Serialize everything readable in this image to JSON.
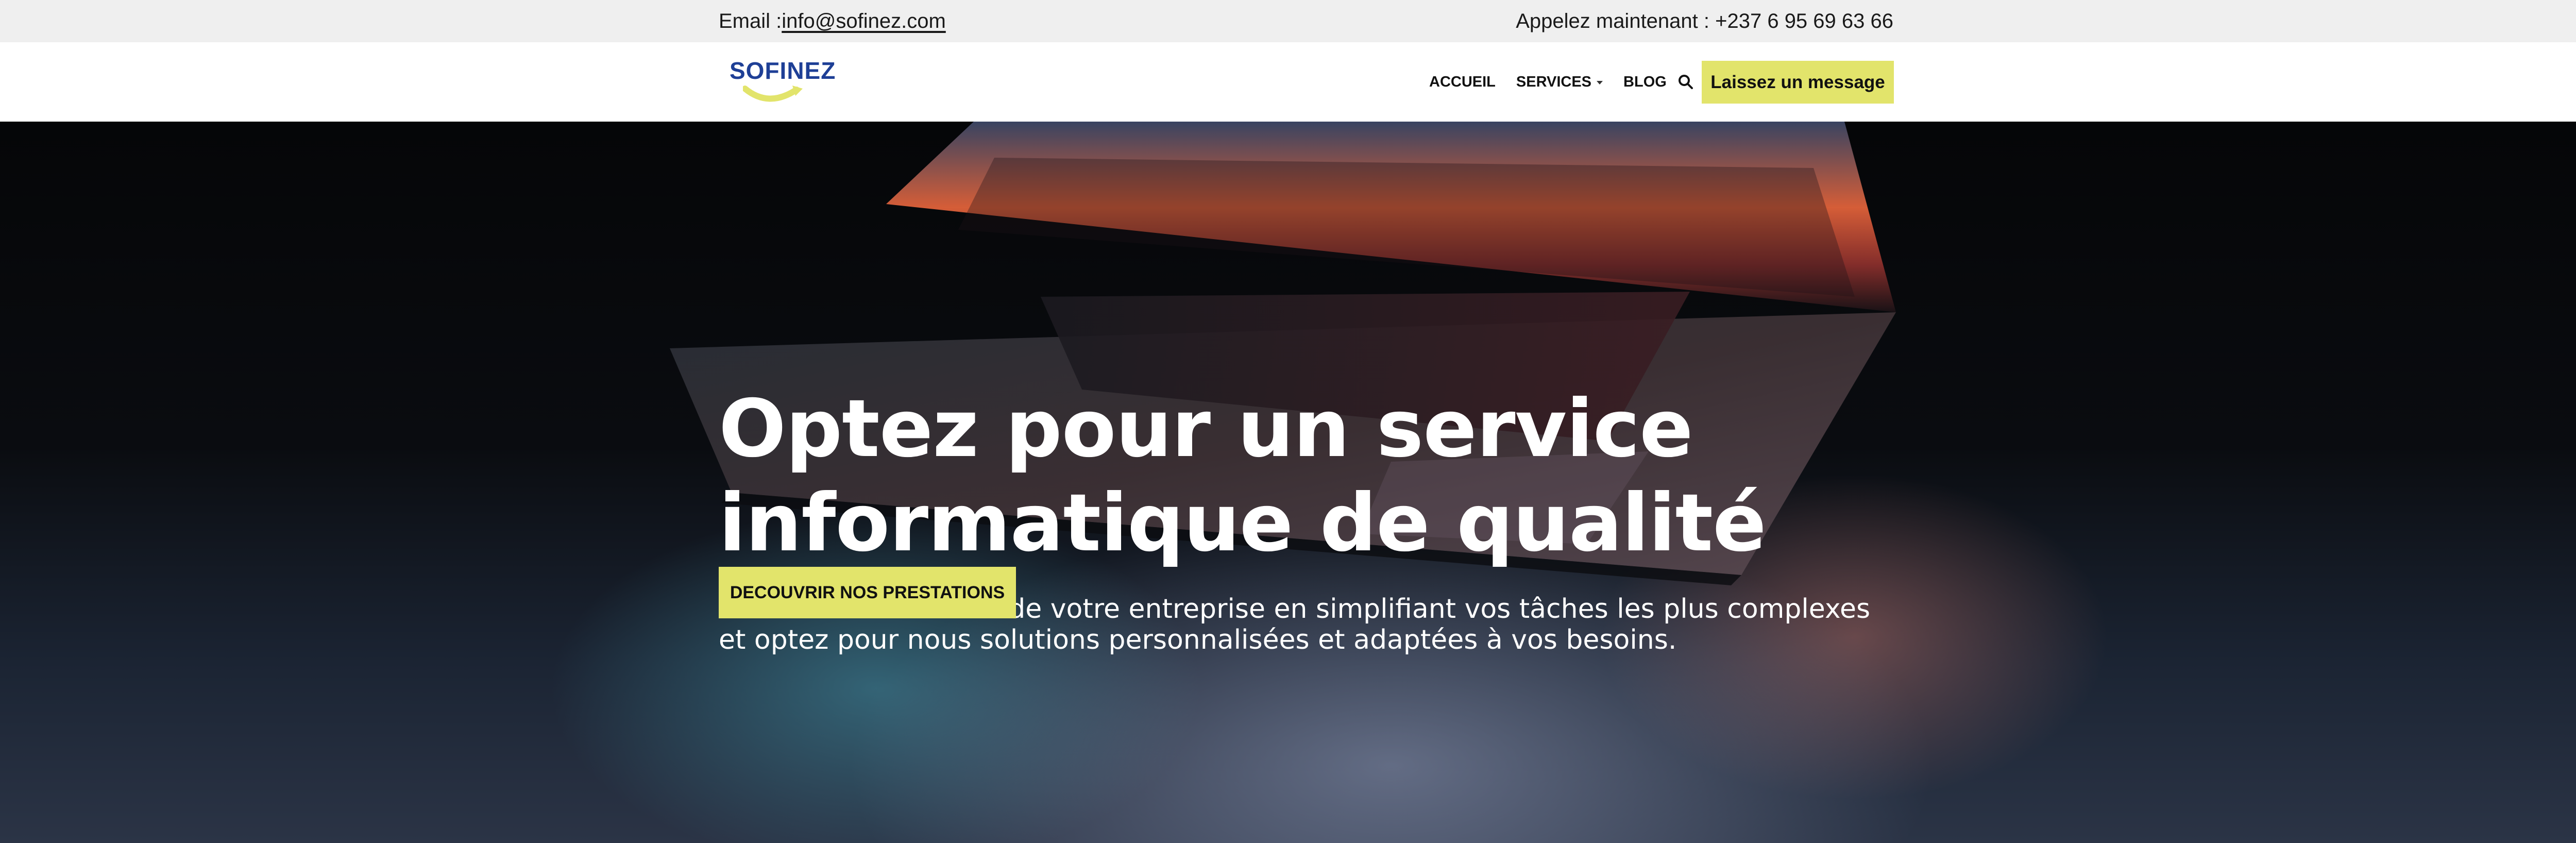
{
  "topbar": {
    "email_label": "Email : ",
    "email_address": "info@sofinez.com",
    "phone_text": "Appelez maintenant : +237 6 95 69 63 66"
  },
  "header": {
    "logo_text": "SOFINEZ",
    "nav": [
      {
        "label": "ACCUEIL"
      },
      {
        "label": "SERVICES"
      },
      {
        "label": "BLOG"
      }
    ],
    "message_button": "Laissez un message"
  },
  "hero": {
    "title_line1": "Optez pour un service",
    "title_line2": "informatique de qualité",
    "subtitle": "Booster la rentabilité de votre entreprise en simplifiant vos tâches les plus complexes et optez pour nous solutions personnalisées et adaptées à vos besoins.",
    "cta": "DECOUVRIR NOS PRESTATIONS"
  },
  "colors": {
    "accent": "#e2e46b",
    "brand": "#1e3f96",
    "topbar_bg": "#efefef"
  },
  "icons": {
    "search": "search-icon",
    "services_dropdown": "chevron-down-icon"
  }
}
